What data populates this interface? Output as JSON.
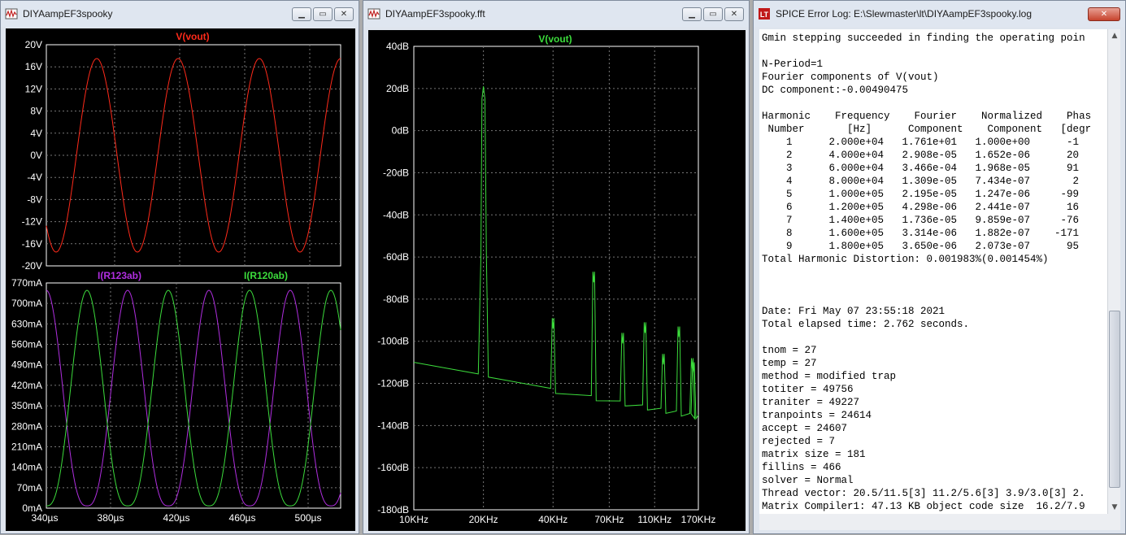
{
  "win1": {
    "title": "DIYAampEF3spooky",
    "top_plot": {
      "trace_label": "V(vout)",
      "trace_color": "#ff2a1a",
      "y_ticks": [
        "20V",
        "16V",
        "12V",
        "8V",
        "4V",
        "0V",
        "-4V",
        "-8V",
        "-12V",
        "-16V",
        "-20V"
      ]
    },
    "bottom_plot": {
      "trace1_label": "I(R123ab)",
      "trace1_color": "#b02ee0",
      "trace2_label": "I(R120ab)",
      "trace2_color": "#3cdc3c",
      "y_ticks": [
        "770mA",
        "700mA",
        "630mA",
        "560mA",
        "490mA",
        "420mA",
        "350mA",
        "280mA",
        "210mA",
        "140mA",
        "70mA",
        "0mA"
      ],
      "x_ticks": [
        "340µs",
        "380µs",
        "420µs",
        "460µs",
        "500µs"
      ]
    }
  },
  "win2": {
    "title": "DIYAampEF3spooky.fft",
    "trace_label": "V(vout)",
    "trace_color": "#3cdc3c",
    "y_ticks": [
      "40dB",
      "20dB",
      "0dB",
      "-20dB",
      "-40dB",
      "-60dB",
      "-80dB",
      "-100dB",
      "-120dB",
      "-140dB",
      "-160dB",
      "-180dB"
    ],
    "x_ticks": [
      "10KHz",
      "20KHz",
      "40KHz",
      "70KHz",
      "110KHz",
      "170KHz"
    ]
  },
  "win3": {
    "title": "SPICE Error Log: E:\\Slewmaster\\lt\\DIYAampEF3spooky.log",
    "lines": [
      "Gmin stepping succeeded in finding the operating poin",
      "",
      "N-Period=1",
      "Fourier components of V(vout)",
      "DC component:-0.00490475",
      "",
      "Harmonic    Frequency    Fourier    Normalized    Phas",
      " Number       [Hz]      Component    Component   [degr",
      "    1      2.000e+04   1.761e+01   1.000e+00      -1",
      "    2      4.000e+04   2.908e-05   1.652e-06      20",
      "    3      6.000e+04   3.466e-04   1.968e-05      91",
      "    4      8.000e+04   1.309e-05   7.434e-07       2",
      "    5      1.000e+05   2.195e-05   1.247e-06     -99",
      "    6      1.200e+05   4.298e-06   2.441e-07      16",
      "    7      1.400e+05   1.736e-05   9.859e-07     -76",
      "    8      1.600e+05   3.314e-06   1.882e-07    -171",
      "    9      1.800e+05   3.650e-06   2.073e-07      95",
      "Total Harmonic Distortion: 0.001983%(0.001454%)",
      "",
      "",
      "",
      "Date: Fri May 07 23:55:18 2021",
      "Total elapsed time: 2.762 seconds.",
      "",
      "tnom = 27",
      "temp = 27",
      "method = modified trap",
      "totiter = 49756",
      "traniter = 49227",
      "tranpoints = 24614",
      "accept = 24607",
      "rejected = 7",
      "matrix size = 181",
      "fillins = 466",
      "solver = Normal",
      "Thread vector: 20.5/11.5[3] 11.2/5.6[3] 3.9/3.0[3] 2.",
      "Matrix Compiler1: 47.13 KB object code size  16.2/7.9"
    ]
  }
}
